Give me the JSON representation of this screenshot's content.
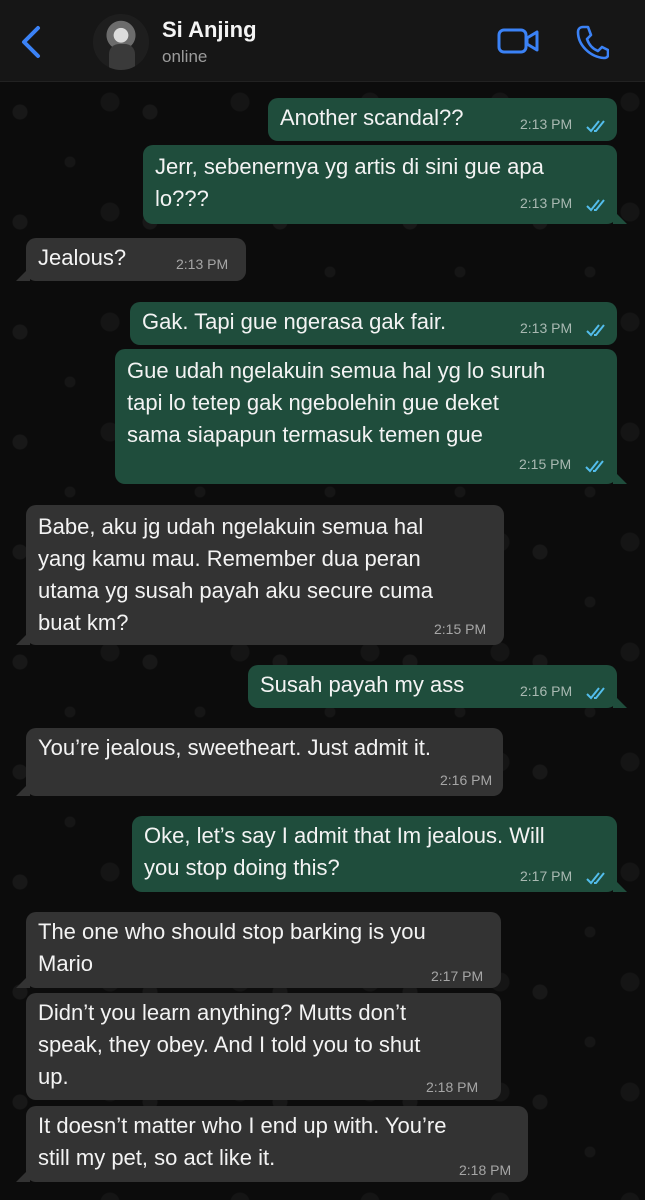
{
  "header": {
    "contact_name": "Si Anjing",
    "status": "online",
    "icons": [
      "chevron-left-icon",
      "video-call-icon",
      "phone-icon"
    ],
    "accent_color": "#3b82f6"
  },
  "colors": {
    "outgoing_bubble": "#1f4d3c",
    "incoming_bubble": "#333333",
    "read_ticks": "#53bdeb"
  },
  "messages": [
    {
      "dir": "out",
      "text": "Another scandal??",
      "time": "2:13 PM",
      "read": true
    },
    {
      "dir": "out",
      "text": "Jerr, sebenernya yg artis di sini gue apa\nlo???",
      "time": "2:13 PM",
      "read": true
    },
    {
      "dir": "in",
      "text": "Jealous?",
      "time": "2:13 PM"
    },
    {
      "dir": "out",
      "text": "Gak. Tapi gue ngerasa gak fair.",
      "time": "2:13 PM",
      "read": true
    },
    {
      "dir": "out",
      "text": "Gue udah ngelakuin semua hal yg lo suruh\ntapi lo tetep gak ngebolehin gue deket\nsama siapapun termasuk temen gue",
      "time": "2:15 PM",
      "read": true
    },
    {
      "dir": "in",
      "text": "Babe, aku jg udah ngelakuin semua hal\nyang kamu mau. Remember dua peran\nutama yg susah payah aku secure cuma\nbuat km?",
      "time": "2:15 PM"
    },
    {
      "dir": "out",
      "text": "Susah payah my ass",
      "time": "2:16 PM",
      "read": true
    },
    {
      "dir": "in",
      "text": "You’re jealous, sweetheart. Just admit it.",
      "time": "2:16 PM"
    },
    {
      "dir": "out",
      "text": "Oke, let’s say I admit that Im jealous. Will\nyou stop doing this?",
      "time": "2:17 PM",
      "read": true
    },
    {
      "dir": "in",
      "text": "The one who should stop barking is you\nMario",
      "time": "2:17 PM"
    },
    {
      "dir": "in",
      "text": "Didn’t you learn anything? Mutts don’t\nspeak, they obey. And I told you to shut\nup.",
      "time": "2:18 PM"
    },
    {
      "dir": "in",
      "text": "It doesn’t matter who I end up with. You’re\nstill my pet, so act like it.",
      "time": "2:18 PM"
    }
  ]
}
